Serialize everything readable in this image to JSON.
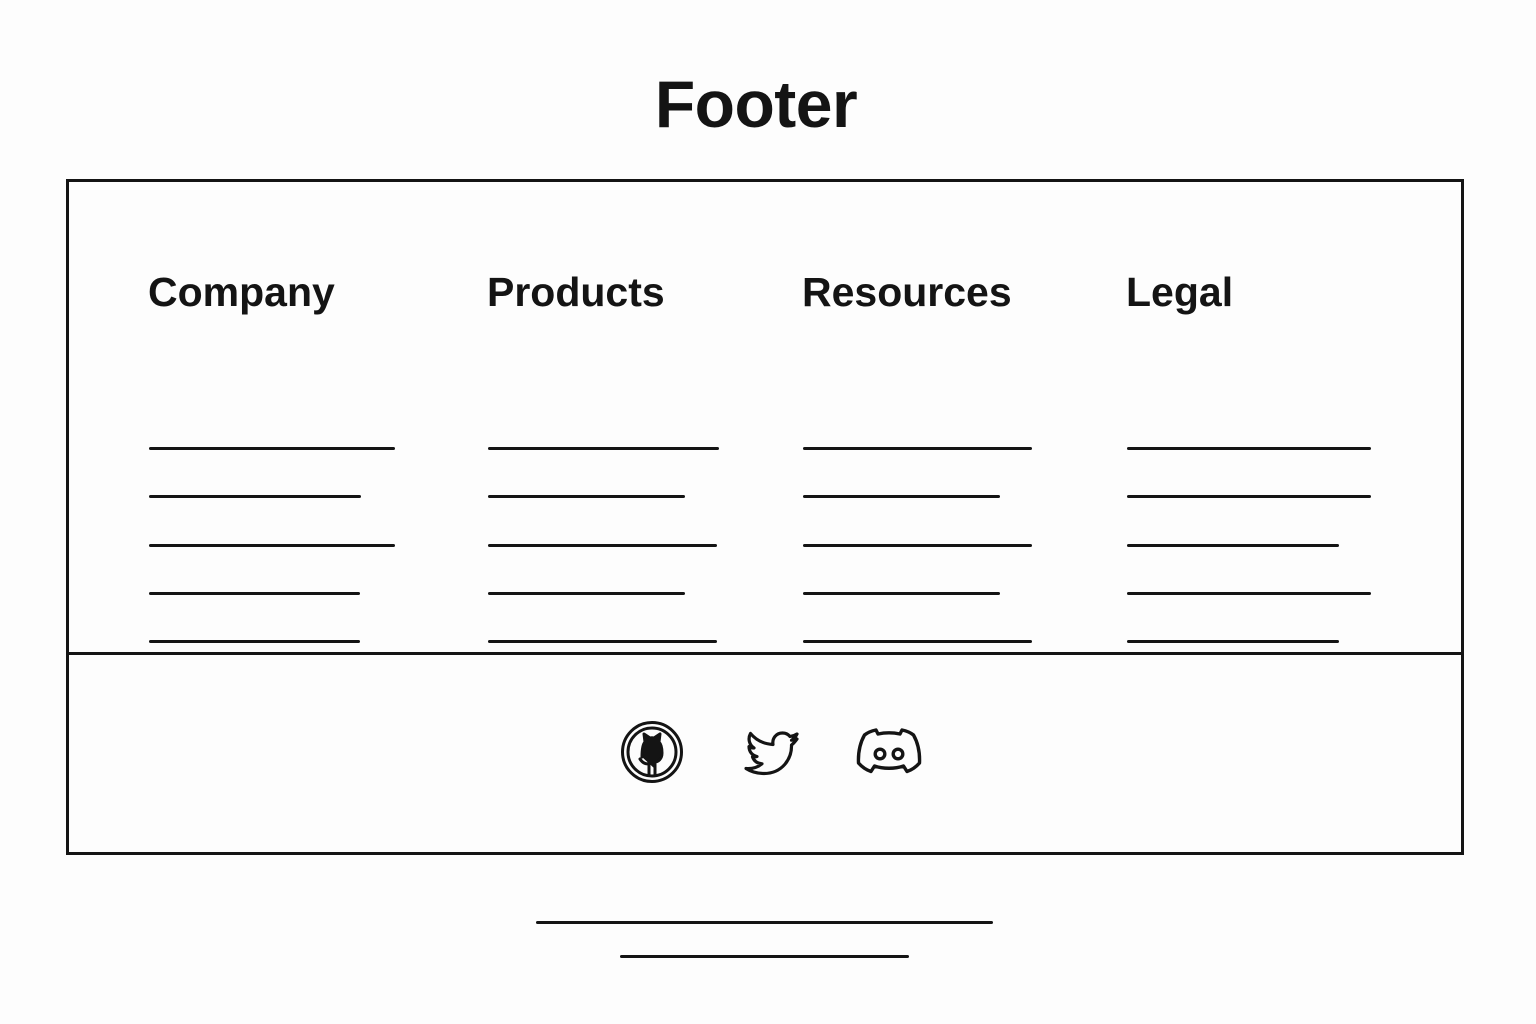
{
  "page": {
    "title": "Footer"
  },
  "footer": {
    "columns": [
      {
        "heading": "Company"
      },
      {
        "heading": "Products"
      },
      {
        "heading": "Resources"
      },
      {
        "heading": "Legal"
      }
    ],
    "social_icons": [
      "github-icon",
      "twitter-icon",
      "discord-icon"
    ]
  },
  "colors": {
    "ink": "#141414",
    "background": "#fdfdfd"
  }
}
